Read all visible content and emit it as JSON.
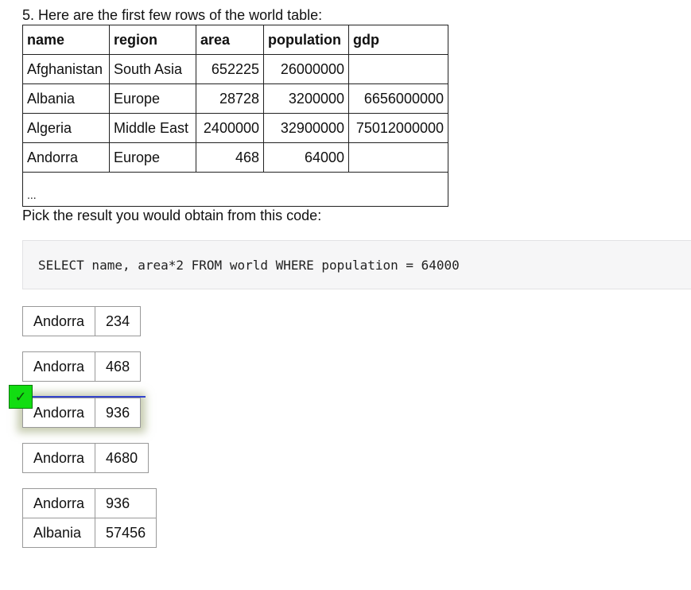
{
  "question": "5. Here are the first few rows of the world table:",
  "world_table": {
    "headers": [
      "name",
      "region",
      "area",
      "population",
      "gdp"
    ],
    "rows": [
      [
        "Afghanistan",
        "South Asia",
        "652225",
        "26000000",
        ""
      ],
      [
        "Albania",
        "Europe",
        "28728",
        "3200000",
        "6656000000"
      ],
      [
        "Algeria",
        "Middle East",
        "2400000",
        "32900000",
        "75012000000"
      ],
      [
        "Andorra",
        "Europe",
        "468",
        "64000",
        ""
      ]
    ],
    "ellipsis": "..."
  },
  "prompt": "Pick the result you would obtain from this code:",
  "code": "SELECT name, area*2 FROM world WHERE population = 64000",
  "options": [
    {
      "rows": [
        [
          "Andorra",
          "234"
        ]
      ]
    },
    {
      "rows": [
        [
          "Andorra",
          "468"
        ]
      ]
    },
    {
      "rows": [
        [
          "Andorra",
          "936"
        ]
      ]
    },
    {
      "rows": [
        [
          "Andorra",
          "4680"
        ]
      ]
    },
    {
      "rows": [
        [
          "Andorra",
          "936"
        ],
        [
          "Albania",
          "57456"
        ]
      ]
    }
  ],
  "selected_option_index": 2,
  "check_mark": "✓",
  "colors": {
    "check_badge": "#12dd12",
    "selection_line": "#3344cc"
  }
}
